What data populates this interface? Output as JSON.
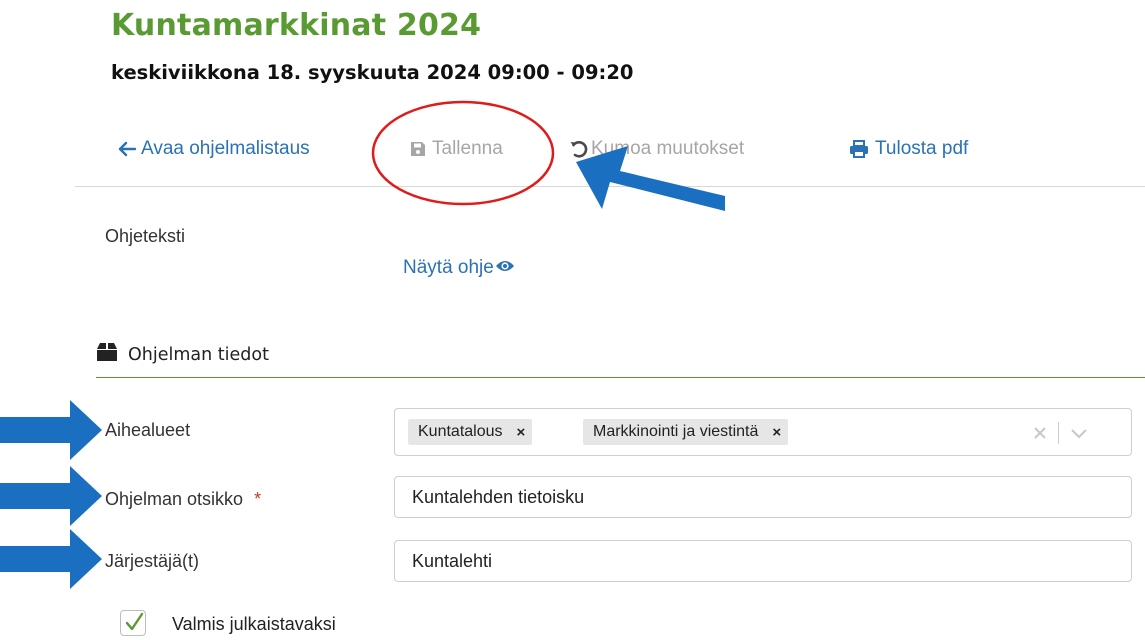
{
  "page": {
    "title": "Kuntamarkkinat 2024",
    "datetime": "keskiviikkona 18. syyskuuta 2024 09:00 - 09:20"
  },
  "toolbar": {
    "back_label": "Avaa ohjelmalistaus",
    "save_label": "Tallenna",
    "undo_label": "Kumoa muutokset",
    "print_label": "Tulosta pdf"
  },
  "help": {
    "label": "Ohjeteksti",
    "link": "Näytä ohje"
  },
  "section": {
    "title": "Ohjelman tiedot"
  },
  "fields": {
    "topics": {
      "label": "Aihealueet",
      "tags": [
        "Kuntatalous",
        "Markkinointi ja viestintä"
      ],
      "tag_remove": "×"
    },
    "program_title": {
      "label": "Ohjelman otsikko",
      "required_mark": "*",
      "value": "Kuntalehden tietoisku"
    },
    "organizers": {
      "label": "Järjestäjä(t)",
      "value": "Kuntalehti"
    },
    "ready": {
      "label": "Valmis julkaistavaksi",
      "checked": true
    }
  },
  "colors": {
    "brand_green": "#5a9a32",
    "link_blue": "#2a72b5",
    "disabled_gray": "#a6a6a6",
    "annotation_arrow": "#1a6fc0",
    "annotation_circle": "#e11a1a"
  }
}
